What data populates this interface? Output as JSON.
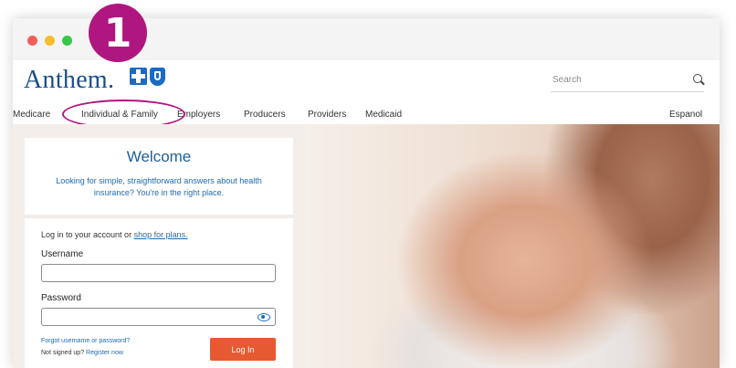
{
  "step_badge": "1",
  "header": {
    "logo_text": "Anthem.",
    "search_placeholder": "Search"
  },
  "nav": {
    "items": [
      "Medicare",
      "Individual & Family",
      "Employers",
      "Producers",
      "Providers",
      "Medicaid"
    ],
    "language": "Espanol"
  },
  "welcome": {
    "title": "Welcome",
    "text": "Looking for simple, straightforward answers about health insurance? You're in the right place."
  },
  "login": {
    "intro": "Log in to your account or",
    "shop_link": "shop for plans.",
    "username_label": "Username",
    "password_label": "Password",
    "forgot_link": "Forgot username or password?",
    "not_signed_up": "Not signed up?",
    "register_link": "Register now",
    "login_button": "Log In"
  },
  "colors": {
    "highlight": "#b0167f",
    "brand_blue": "#1b4f86",
    "login_button": "#e65a32"
  }
}
